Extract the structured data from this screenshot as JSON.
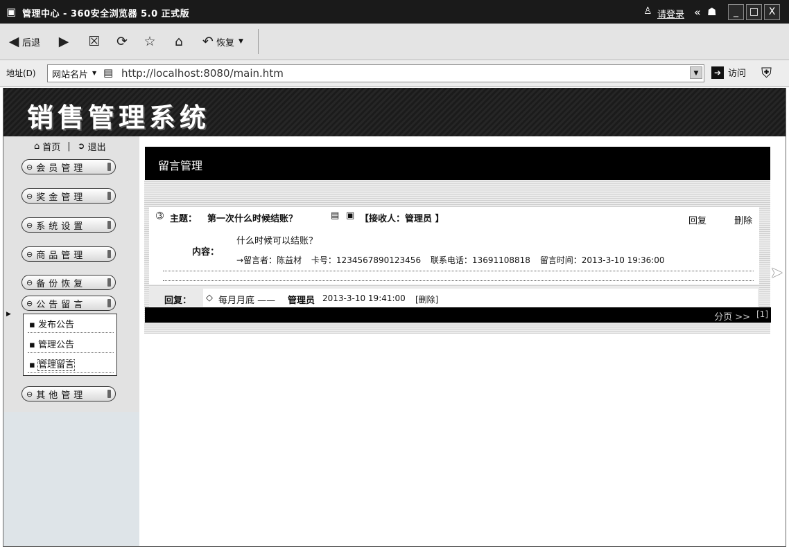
{
  "window": {
    "title": "管理中心 - 360安全浏览器 5.0 正式版",
    "login_label": "请登录",
    "controls": [
      "_",
      "□",
      "X"
    ]
  },
  "toolbar": {
    "back_label": "后退",
    "restore_label": "恢复"
  },
  "address_bar": {
    "label": "地址(D)",
    "site_card_label": "网站名片",
    "url": "http://localhost:8080/main.htm",
    "go_label": "访问"
  },
  "page": {
    "system_title": "销售管理系统",
    "home_label": "首页",
    "separator": "|",
    "logout_label": "退出"
  },
  "sidebar": {
    "menu": [
      {
        "label": "会员管理"
      },
      {
        "label": "奖金管理"
      },
      {
        "label": "系统设置"
      },
      {
        "label": "商品管理"
      },
      {
        "label": "备份恢复"
      },
      {
        "label": "公告留言"
      },
      {
        "label": "其他管理"
      }
    ],
    "submenu": [
      {
        "label": "发布公告"
      },
      {
        "label": "管理公告"
      },
      {
        "label": "管理留言"
      }
    ]
  },
  "main": {
    "section_title": "留言管理",
    "message": {
      "subject_label": "主题：",
      "subject": "第一次什么时候结账？",
      "recipient": "【接收人：管理员 】",
      "reply_action": "回复",
      "delete_action": "删除",
      "content_label": "内容：",
      "content": "什么时候可以结账？",
      "author_label": "→留言者：",
      "author": "陈益材",
      "card_label": "卡号：",
      "card_no": "1234567890123456",
      "phone_label": "联系电话：",
      "phone": "13691108818",
      "time_label": "留言时间：",
      "time": "2013-3-10 19:36:00"
    },
    "reply": {
      "label": "回复：",
      "bullet": "◇",
      "text": "每月月底 ——",
      "replier": "管理员",
      "time": "2013-3-10 19:41:00",
      "delete_action": "[删除]"
    },
    "pagination": {
      "label": "分页 >>",
      "page": "[1]"
    }
  },
  "colors": {
    "title_bar": "#1a1a1a",
    "banner": "#1b1b1b",
    "main_header": "#000000",
    "sidebar_bg": "#dee4e8"
  }
}
